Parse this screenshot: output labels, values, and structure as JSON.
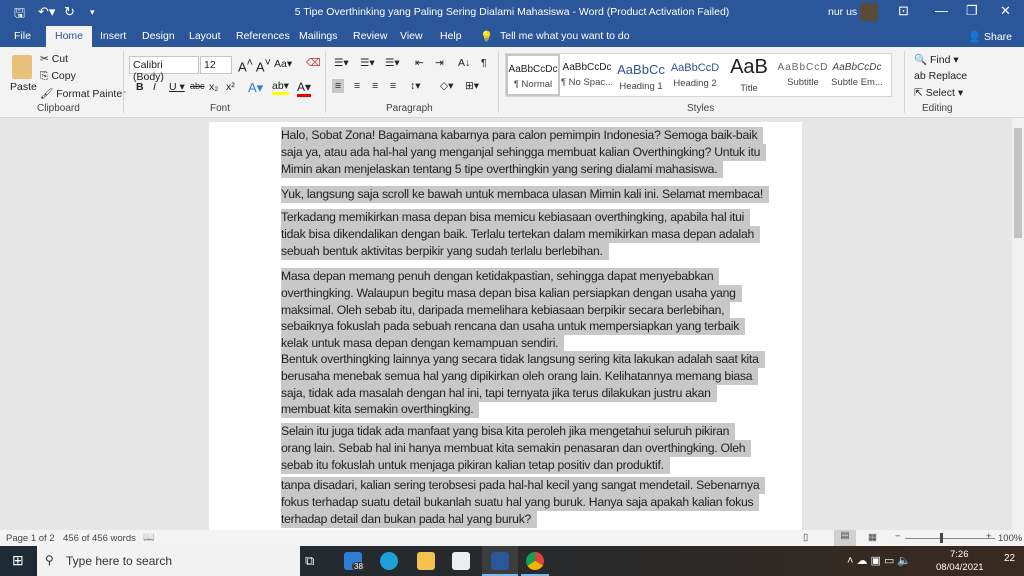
{
  "window": {
    "title": "5 Tipe Overthinking yang Paling Sering Dialami Mahasiswa  -  Word (Product Activation Failed)",
    "user": "nur us"
  },
  "tabs": [
    "File",
    "Home",
    "Insert",
    "Design",
    "Layout",
    "References",
    "Mailings",
    "Review",
    "View",
    "Help"
  ],
  "tell_me": "Tell me what you want to do",
  "share": "Share",
  "clipboard": {
    "paste": "Paste",
    "cut": "Cut",
    "copy": "Copy",
    "format_painter": "Format Painter",
    "group": "Clipboard"
  },
  "font": {
    "name": "Calibri (Body)",
    "size": "12",
    "group": "Font"
  },
  "paragraph": {
    "group": "Paragraph"
  },
  "styles": {
    "group": "Styles",
    "items": [
      {
        "sample": "AaBbCcDc",
        "name": "¶ Normal"
      },
      {
        "sample": "AaBbCcDc",
        "name": "¶ No Spac..."
      },
      {
        "sample": "AaBbCc",
        "name": "Heading 1"
      },
      {
        "sample": "AaBbCcD",
        "name": "Heading 2"
      },
      {
        "sample": "AaB",
        "name": "Title"
      },
      {
        "sample": "AaBbCcD",
        "name": "Subtitle"
      },
      {
        "sample": "AaBbCcDc",
        "name": "Subtle Em..."
      }
    ]
  },
  "editing": {
    "find": "Find",
    "replace": "Replace",
    "select": "Select",
    "group": "Editing"
  },
  "document": {
    "paragraphs": [
      [
        "Halo, Sobat Zona! Bagaimana kabarnya para calon pemimpin Indonesia? Semoga baik-baik",
        "saja ya, atau ada hal-hal yang menganjal sehingga membuat kalian Overthingking? Untuk itu",
        "Mimin akan menjelaskan tentang 5 tipe overthingkin yang sering dialami mahasiswa."
      ],
      [
        "Yuk, langsung saja scroll ke bawah untuk membaca ulasan Mimin kali ini. Selamat membaca!"
      ],
      [
        "Terkadang memikirkan masa depan bisa memicu kebiasaan overthingking, apabila hal itui",
        "tidak bisa dikendalikan dengan baik. Terlalu tertekan dalam memikirkan masa depan adalah",
        "sebuah bentuk aktivitas berpikir yang sudah terlalu berlebihan."
      ],
      [
        "Masa depan memang penuh dengan ketidakpastian, sehingga dapat menyebabkan",
        "overthingking. Walaupun begitu masa depan bisa kalian persiapkan dengan usaha yang",
        "maksimal. Oleh sebab itu, daripada memelihara kebiasaan berpikir secara berlebihan,",
        "sebaiknya fokuslah pada sebuah rencana dan usaha untuk mempersiapkan yang terbaik",
        "kelak untuk masa depan dengan kemampuan sendiri."
      ],
      [
        "Bentuk overthingking lainnya yang secara tidak langsung sering kita lakukan adalah saat kita",
        "berusaha menebak semua hal yang dipikirkan oleh orang lain. Kelihatannya memang biasa",
        "saja, tidak ada masalah dengan hal ini, tapi ternyata jika terus dilakukan justru akan",
        "membuat kita semakin overthingking."
      ],
      [
        "Selain itu juga tidak ada manfaat yang bisa kita peroleh jika mengetahui seluruh pikiran",
        "orang lain. Sebab hal ini hanya membuat kita semakin penasaran dan overthingking. Oleh",
        "sebab itu fokuslah untuk menjaga pikiran kalian tetap positiv dan produktif."
      ],
      [
        "tanpa disadari, kalian sering terobsesi pada hal-hal kecil yang sangat mendetail. Sebenarnya",
        "fokus terhadap suatu detail bukanlah suatu hal yang buruk. Hanya saja apakah kalian fokus",
        "terhadap detail dan bukan pada hal yang buruk?"
      ]
    ]
  },
  "status": {
    "page": "Page 1 of 2",
    "words": "456 of 456 words",
    "zoom": "100%"
  },
  "taskbar": {
    "search_placeholder": "Type here to search",
    "mail_badge": "38",
    "time": "7:26",
    "date": "08/04/2021",
    "notifications": "22"
  },
  "colors": {
    "word_blue": "#2b579a",
    "highlight": "#c8c8c8"
  }
}
